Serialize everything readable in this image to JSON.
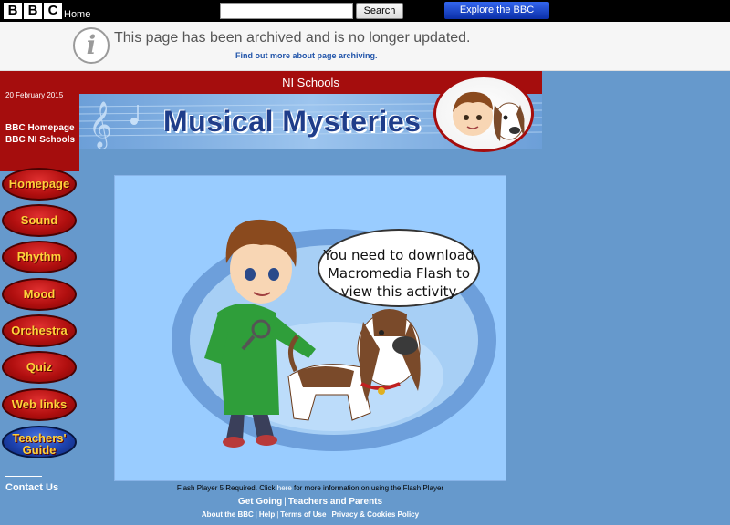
{
  "topbar": {
    "logo_letters": [
      "B",
      "B",
      "C"
    ],
    "home_label": "Home",
    "search_placeholder": "",
    "search_button": "Search",
    "explore_button": "Explore the BBC"
  },
  "archive": {
    "message": "This page has been archived and is no longer updated.",
    "link": "Find out more about page archiving.",
    "icon": "info-icon"
  },
  "sidebar": {
    "date": "20 February 2015",
    "bbc_homepage": "BBC Homepage",
    "bbc_ni_schools": "BBC NI Schools",
    "nav": [
      {
        "label": "Homepage",
        "color": "#b10f0f"
      },
      {
        "label": "Sound",
        "color": "#b10f0f"
      },
      {
        "label": "Rhythm",
        "color": "#b10f0f"
      },
      {
        "label": "Mood",
        "color": "#b10f0f"
      },
      {
        "label": "Orchestra",
        "color": "#b10f0f"
      },
      {
        "label": "Quiz",
        "color": "#b10f0f"
      },
      {
        "label": "Web links",
        "color": "#b10f0f"
      },
      {
        "label": "Teachers' Guide",
        "color": "#1d43b0"
      }
    ],
    "contact": "Contact Us"
  },
  "header": {
    "section": "NI Schools",
    "title": "Musical Mysteries"
  },
  "flash": {
    "bubble_text": "You need to download Macromedia Flash to view this activity"
  },
  "footer": {
    "flash_note_before": "Flash Player 5 Required. Click ",
    "flash_note_link": "here",
    "flash_note_after": " for more information on using the Flash Player",
    "links1": [
      "Get Going",
      "Teachers and Parents"
    ],
    "links2": [
      "About the BBC",
      "Help",
      "Terms of Use",
      "Privacy & Cookies Policy"
    ]
  },
  "colors": {
    "page_bg": "#6699cc",
    "brand_red": "#a50d0d",
    "nav_text": "#ffd23a",
    "flash_bg": "#99ccff"
  }
}
